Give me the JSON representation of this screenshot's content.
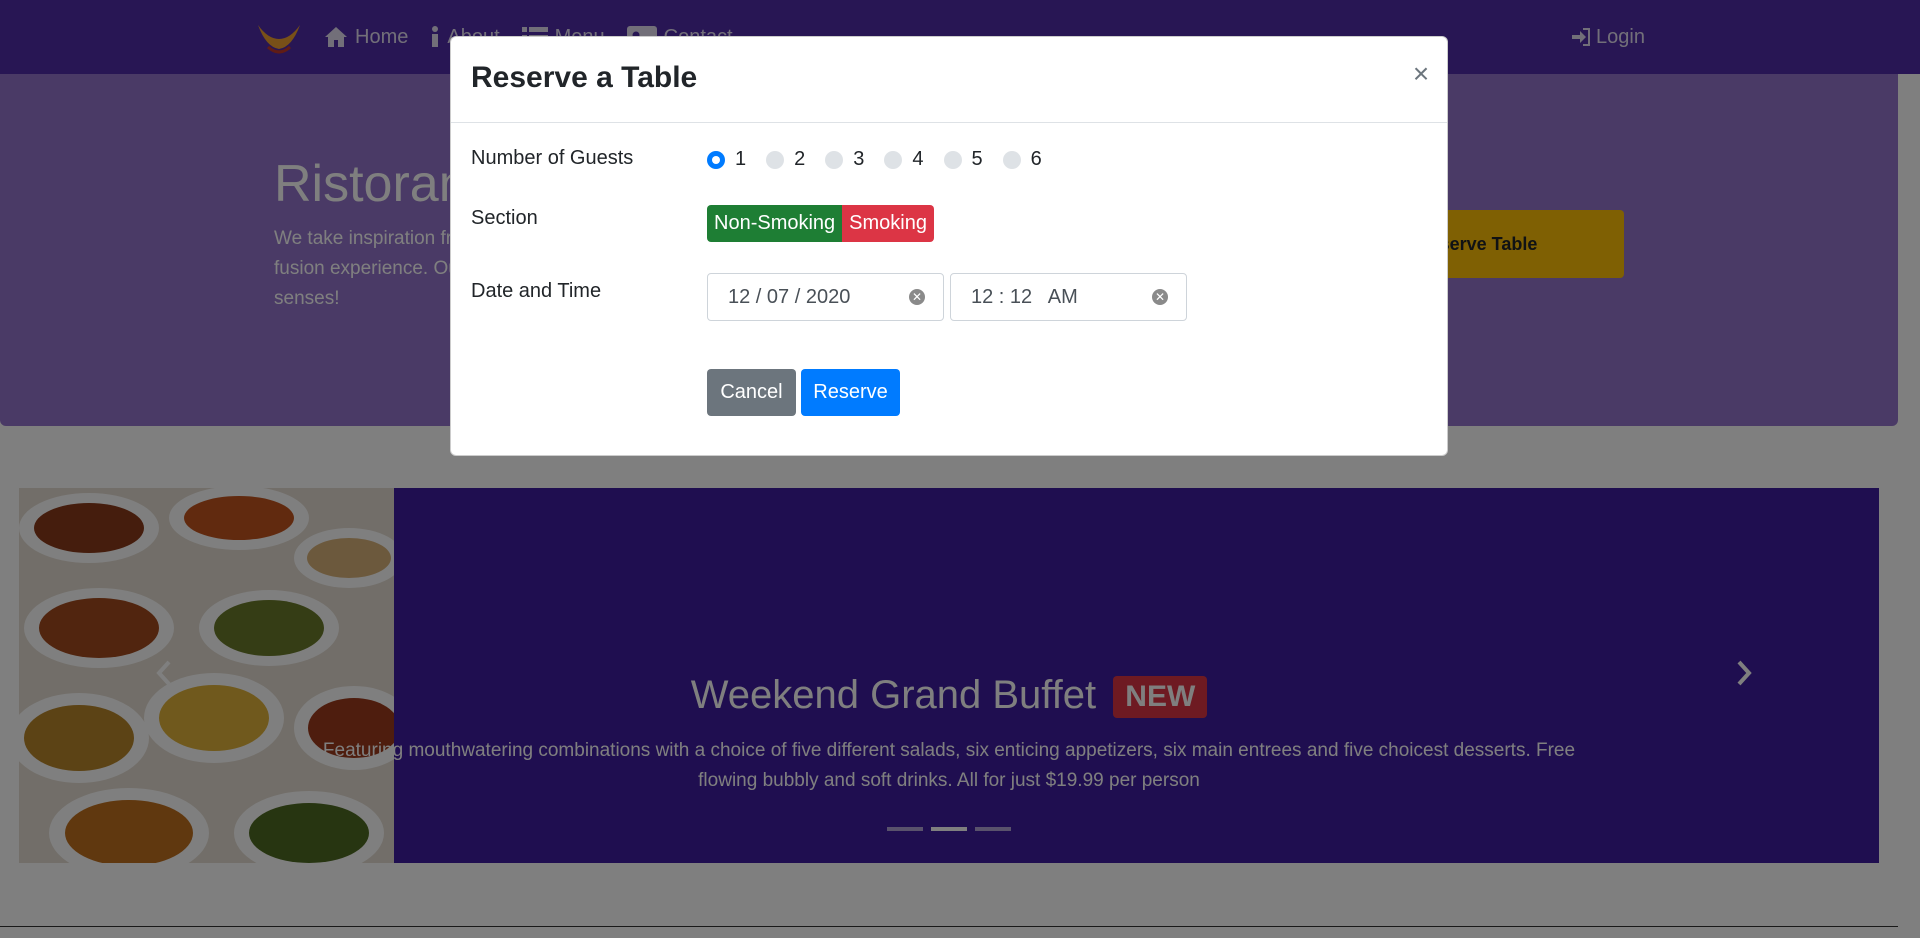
{
  "nav": {
    "items": [
      {
        "label": "Home",
        "icon": "home-icon"
      },
      {
        "label": "About",
        "icon": "info-icon"
      },
      {
        "label": "Menu",
        "icon": "list-icon"
      },
      {
        "label": "Contact",
        "icon": "address-card-icon"
      }
    ],
    "login_label": "Login"
  },
  "jumbotron": {
    "title": "Ristorante Con Fusion",
    "text": "We take inspiration from the World's best cuisines, and create a unique fusion experience. Our lipsmacking creations will tickle your culinary senses!",
    "button_label": "Reserve Table"
  },
  "carousel": {
    "title": "Weekend Grand Buffet",
    "badge": "NEW",
    "text": "Featuring mouthwatering combinations with a choice of five different salads, six enticing appetizers, six main entrees and five choicest desserts. Free flowing bubbly and soft drinks. All for just $19.99 per person",
    "active_index": 1,
    "indicator_count": 3
  },
  "modal": {
    "title": "Reserve a Table",
    "close_symbol": "×",
    "guests_label": "Number of Guests",
    "guest_options": [
      "1",
      "2",
      "3",
      "4",
      "5",
      "6"
    ],
    "selected_guests": "1",
    "section_label": "Section",
    "section_options": [
      "Non-Smoking",
      "Smoking"
    ],
    "datetime_label": "Date and Time",
    "date_value": "12 / 07 / 2020",
    "time_value": "12 : 12   AM",
    "cancel_label": "Cancel",
    "reserve_label": "Reserve"
  },
  "colors": {
    "navbar": "#512da8",
    "jumbotron": "#9575cd",
    "carousel": "#3f1ca0",
    "primary": "#007bff",
    "secondary": "#6c757d",
    "success": "#1e7e34",
    "danger": "#dc3545",
    "warning": "#ffc107"
  }
}
